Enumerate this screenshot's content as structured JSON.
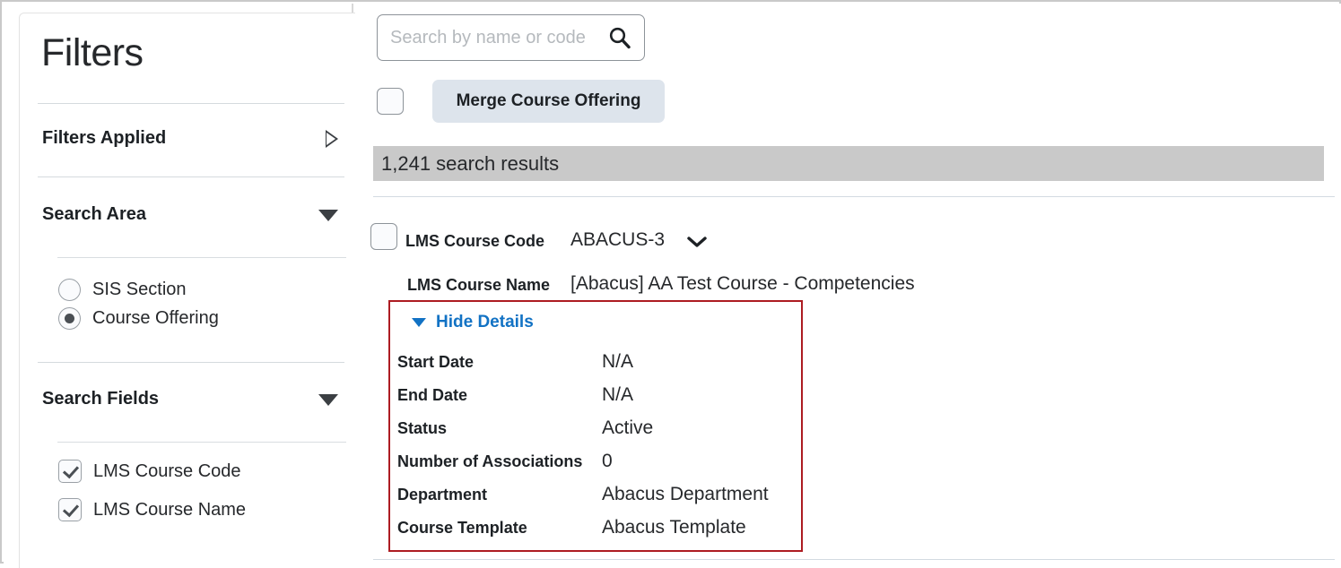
{
  "sidebar": {
    "title": "Filters",
    "sections": [
      {
        "heading": "Filters Applied",
        "toggle_icon": "triangle-right-icon",
        "expanded": false
      },
      {
        "heading": "Search Area",
        "toggle_icon": "triangle-down-icon",
        "expanded": true
      },
      {
        "heading": "Search Fields",
        "toggle_icon": "triangle-down-icon",
        "expanded": true
      }
    ],
    "search_area": {
      "options": [
        {
          "label": "SIS Section",
          "selected": false
        },
        {
          "label": "Course Offering",
          "selected": true
        }
      ]
    },
    "search_fields": {
      "options": [
        {
          "label": "LMS Course Code",
          "checked": true
        },
        {
          "label": "LMS Course Name",
          "checked": true
        }
      ]
    }
  },
  "main": {
    "search": {
      "placeholder": "Search by name or code",
      "value": "",
      "icon": "search-icon"
    },
    "select_all_checkbox": {
      "checked": false
    },
    "merge_button": {
      "label": "Merge Course Offering"
    },
    "results_bar": {
      "text": "1,241 search results"
    },
    "result": {
      "checkbox": {
        "checked": false
      },
      "code_label": "LMS Course Code",
      "code_value": "ABACUS-3",
      "code_chevron": "chevron-down-icon",
      "name_label": "LMS Course Name",
      "name_value": "[Abacus] AA Test Course - Competencies",
      "details_toggle": {
        "label": "Hide Details",
        "icon": "triangle-down-icon"
      },
      "details": [
        {
          "label": "Start Date",
          "value": "N/A"
        },
        {
          "label": "End Date",
          "value": "N/A"
        },
        {
          "label": "Status",
          "value": "Active"
        },
        {
          "label": "Number of Associations",
          "value": "0"
        },
        {
          "label": "Department",
          "value": "Abacus Department"
        },
        {
          "label": "Course Template",
          "value": "Abacus Template"
        }
      ]
    }
  },
  "colors": {
    "highlight_border": "#ad1c22",
    "link": "#1272c4",
    "results_bar_bg": "#c9c9c9",
    "merge_button_bg": "#dde4ec"
  }
}
